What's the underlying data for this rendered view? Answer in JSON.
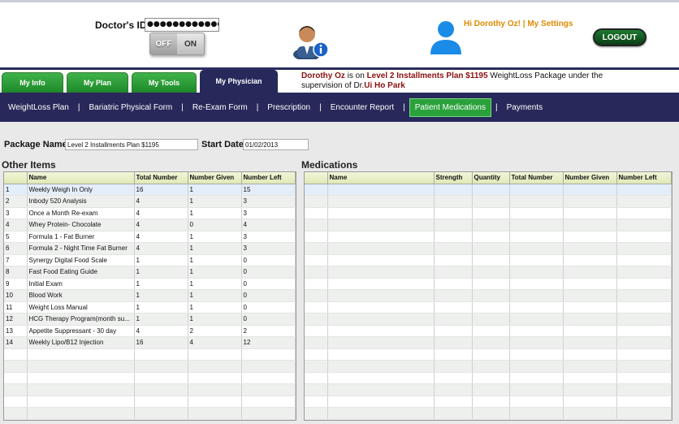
{
  "header": {
    "doctor_id_label": "Doctor's ID:",
    "doctor_id_value": "●●●●●●●●●●●●●●●●●●●",
    "toggle_off": "OFF",
    "toggle_on": "ON",
    "greeting": "Hi Dorothy Oz! | My Settings",
    "logout": "LOGOUT"
  },
  "tabs": [
    {
      "label": "My Info"
    },
    {
      "label": "My Plan"
    },
    {
      "label": "My Tools"
    },
    {
      "label": "My Physician"
    }
  ],
  "status": {
    "name": "Dorothy Oz",
    "text1": " is on ",
    "plan": "Level 2 Installments Plan $1195",
    "text2": " WeightLoss Package under the supervision of Dr.",
    "doctor": "Ui Ho Park"
  },
  "subnav": [
    {
      "label": "WeightLoss Plan"
    },
    {
      "label": "Bariatric Physical Form"
    },
    {
      "label": "Re-Exam Form"
    },
    {
      "label": "Prescription"
    },
    {
      "label": "Encounter Report"
    },
    {
      "label": "Patient Medications"
    },
    {
      "label": "Payments"
    }
  ],
  "package": {
    "name_label": "Package Name :",
    "name_value": "Level 2 Installments Plan $1195",
    "start_label": "Start Date:",
    "start_value": "01/02/2013"
  },
  "other_items": {
    "title": "Other Items",
    "columns": [
      "",
      "Name",
      "Total Number",
      "Number Given",
      "Number Left"
    ],
    "rows": [
      [
        "1",
        "Weekly Weigh In Only",
        "16",
        "1",
        "15"
      ],
      [
        "2",
        "Inbody 520 Analysis",
        "4",
        "1",
        "3"
      ],
      [
        "3",
        "Once a Month Re-exam",
        "4",
        "1",
        "3"
      ],
      [
        "4",
        "Whey Protein- Chocolate",
        "4",
        "0",
        "4"
      ],
      [
        "5",
        "Formula 1 - Fat Burner",
        "4",
        "1",
        "3"
      ],
      [
        "6",
        "Formula 2 - Night Time Fat Burner",
        "4",
        "1",
        "3"
      ],
      [
        "7",
        "Synergy Digital Food Scale",
        "1",
        "1",
        "0"
      ],
      [
        "8",
        "Fast Food Eating Guide",
        "1",
        "1",
        "0"
      ],
      [
        "9",
        "Initial Exam",
        "1",
        "1",
        "0"
      ],
      [
        "10",
        "Blood Work",
        "1",
        "1",
        "0"
      ],
      [
        "11",
        "Weight Loss Manual",
        "1",
        "1",
        "0"
      ],
      [
        "12",
        "HCG Therapy Program(month su...",
        "1",
        "1",
        "0"
      ],
      [
        "13",
        "Appetite Suppressant - 30 day",
        "4",
        "2",
        "2"
      ],
      [
        "14",
        "Weekly Lipo/B12 Injection",
        "16",
        "4",
        "12"
      ]
    ]
  },
  "medications": {
    "title": "Medications",
    "columns": [
      "",
      "Name",
      "Strength",
      "Quantity",
      "Total Number",
      "Number Given",
      "Number Left"
    ]
  }
}
